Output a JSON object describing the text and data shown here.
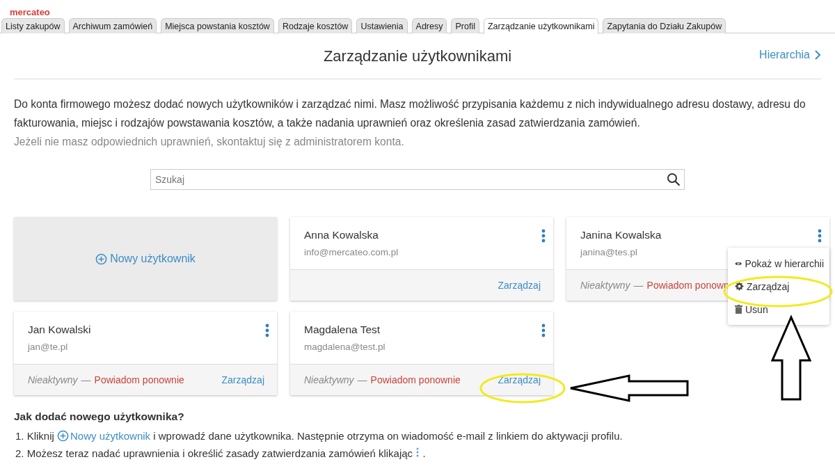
{
  "logo": "mercateo",
  "tabs": [
    {
      "label": "Listy zakupów",
      "selected": false
    },
    {
      "label": "Archiwum zamówień",
      "selected": false
    },
    {
      "label": "Miejsca powstania kosztów",
      "selected": false
    },
    {
      "label": "Rodzaje kosztów",
      "selected": false
    },
    {
      "label": "Ustawienia",
      "selected": false
    },
    {
      "label": "Adresy",
      "selected": false
    },
    {
      "label": "Profil",
      "selected": false
    },
    {
      "label": "Zarządzanie użytkownikami",
      "selected": true
    },
    {
      "label": "Zapytania do Działu Zakupów",
      "selected": false
    }
  ],
  "page": {
    "title": "Zarządzanie użytkownikami",
    "hierarchy_link": "Hierarchia"
  },
  "intro": "Do konta firmowego możesz dodać nowych użytkowników i zarządzać nimi. Masz możliwość przypisania każdemu z nich indywidualnego adresu dostawy, adresu do fakturowania, miejsc i rodzajów powstawania kosztów, a także nadania uprawnień oraz określenia zasad zatwierdzania zamówień.",
  "note": "Jeżeli nie masz odpowiednich uprawnień, skontaktuj się z administratorem konta.",
  "search": {
    "placeholder": "Szukaj"
  },
  "new_user": "Nowy użytkownik",
  "users": [
    {
      "name": "Anna Kowalska",
      "email": "info@mercateo.com.pl",
      "manage": "Zarządzaj",
      "menu_open": false
    },
    {
      "name": "Janina Kowalska",
      "email": "janina@tes.pl",
      "status": "Nieaktywny",
      "separator": "—",
      "resend": "Powiadom ponown",
      "menu_open": true
    },
    {
      "name": "Jan Kowalski",
      "email": "jan@te.pl",
      "status": "Nieaktywny",
      "separator": "—",
      "resend": "Powiadom ponownie",
      "manage": "Zarządzaj",
      "menu_open": false
    },
    {
      "name": "Magdalena Test",
      "email": "magdalena@test.pl",
      "status": "Nieaktywny",
      "separator": "—",
      "resend": "Powiadom ponownie",
      "manage": "Zarządzaj",
      "menu_open": false
    }
  ],
  "menu": [
    {
      "kind": "eye",
      "label": "Pokaż w hierarchii"
    },
    {
      "kind": "gear",
      "label": "Zarządzaj"
    },
    {
      "kind": "trash",
      "label": "Usuń"
    }
  ],
  "help": {
    "title": "Jak dodać nowego użytkownika?",
    "step1": {
      "before": "1. Kliknij",
      "link": "Nowy użytkownik",
      "after": "i wprowadź dane użytkownika. Następnie otrzyma on wiadomość e-mail z linkiem do aktywacji profilu."
    },
    "step2": {
      "before": "2. Możesz teraz nadać uprawnienia i określić zasady zatwierdzania zamówień klikając",
      "after": "."
    }
  }
}
